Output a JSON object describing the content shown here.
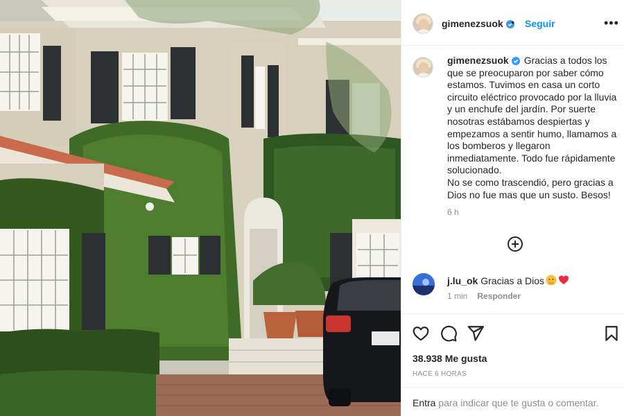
{
  "post": {
    "username": "gimenezsuok",
    "follow_label": "Seguir",
    "more_label": "•••",
    "caption_username": "gimenezsuok",
    "caption": "Gracias a todos los que se preocuparon por saber cómo estamos. Tuvimos en casa un corto circuito eléctrico provocado por la lluvia y un enchufe del jardín. Por suerte nosotras estábamos despiertas y empezamos a sentir humo, llamamos a los bomberos y llegaron inmediatamente. Todo fue rápidamente solucionado.\nNo se como trascendió, pero gracias a Dios no fue mas que un susto. Besos!",
    "caption_time": "6 h",
    "likes": "38.938 Me gusta",
    "posted": "HACE 6 HORAS"
  },
  "comment": {
    "username": "j.lu_ok",
    "text": "Gracias a Dios",
    "emoji": [
      "praying-face-emoji",
      "red-heart-emoji"
    ],
    "time": "1 min",
    "reply_label": "Responder"
  },
  "footer": {
    "link": "Entra",
    "text": " para indicar que te gusta o comentar."
  },
  "icons": {
    "verified": "verified-badge-icon",
    "plus": "plus-circle-icon",
    "like": "heart-icon",
    "comment": "comment-icon",
    "share": "share-icon",
    "save": "bookmark-icon"
  },
  "colors": {
    "accent": "#0095f6",
    "verified": "#3897f0",
    "muted": "#8e8e8e",
    "heart": "#ed2a3b"
  }
}
